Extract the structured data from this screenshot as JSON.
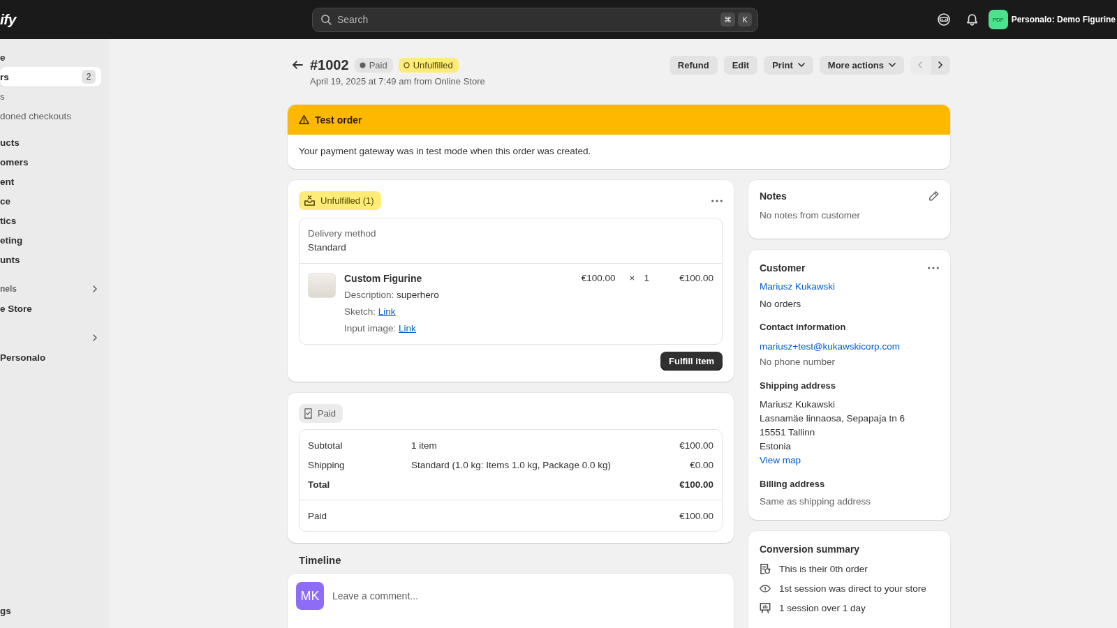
{
  "topbar": {
    "logo": "ify",
    "search": {
      "placeholder": "Search",
      "shortcut": [
        "⌘",
        "K"
      ]
    },
    "store": {
      "initials": "PDF",
      "name": "Personalo: Demo Figurine"
    }
  },
  "sidebar": {
    "groups": [
      {
        "items": [
          {
            "kind": "item",
            "label": "e",
            "selected": false
          },
          {
            "kind": "item",
            "label": "rs",
            "badge": "2",
            "selected": true
          },
          {
            "kind": "sub",
            "label": "s",
            "selected": false
          },
          {
            "kind": "sub",
            "label": "doned checkouts",
            "selected": false
          }
        ]
      },
      {
        "items": [
          {
            "kind": "item",
            "label": "ucts",
            "selected": false
          },
          {
            "kind": "item",
            "label": "omers",
            "selected": false
          },
          {
            "kind": "item",
            "label": "ent",
            "selected": false
          },
          {
            "kind": "item",
            "label": "ce",
            "selected": false
          },
          {
            "kind": "item",
            "label": "tics",
            "selected": false
          },
          {
            "kind": "item",
            "label": "eting",
            "selected": false
          },
          {
            "kind": "item",
            "label": "unts",
            "selected": false
          }
        ]
      },
      {
        "items": [
          {
            "kind": "section",
            "label": "nels"
          },
          {
            "kind": "item",
            "label": "e Store",
            "selected": false
          }
        ]
      },
      {
        "items": [
          {
            "kind": "section"
          },
          {
            "kind": "item",
            "label": "Personalo",
            "selected": false
          }
        ]
      }
    ],
    "footer": {
      "label": "gs",
      "selected": false
    }
  },
  "order": {
    "title": "#1002",
    "badges": [
      {
        "kind": "paid",
        "label": "Paid"
      },
      {
        "kind": "unfulfilled",
        "label": "Unfulfilled"
      }
    ],
    "subtitle": "April 19, 2025 at 7:49 am from Online Store",
    "actions": [
      {
        "label": "Refund",
        "dropdown": false
      },
      {
        "label": "Edit",
        "dropdown": false
      },
      {
        "label": "Print",
        "dropdown": true
      },
      {
        "label": "More actions",
        "dropdown": true
      }
    ],
    "pager": [
      {
        "kind": "previous",
        "disabled": true
      },
      {
        "kind": "next",
        "disabled": false
      }
    ]
  },
  "banner": {
    "title": "Test order",
    "message": "Your payment gateway was in test mode when this order was created."
  },
  "fulfillment": {
    "status": {
      "kind": "unfulfilled",
      "label": "Unfulfilled (1)"
    },
    "delivery": {
      "label": "Delivery method",
      "value": "Standard"
    },
    "line_items": [
      {
        "name": "Custom Figurine",
        "properties": [
          {
            "kind": "text",
            "label": "Description:",
            "value": "superhero"
          },
          {
            "kind": "link",
            "label": "Sketch:",
            "value": "Link"
          },
          {
            "kind": "link",
            "label": "Input image:",
            "value": "Link"
          }
        ],
        "price": "€100.00",
        "times": "×",
        "quantity": "1",
        "total": "€100.00"
      }
    ],
    "action": "Fulfill item"
  },
  "payment": {
    "status": {
      "kind": "paid",
      "label": "Paid"
    },
    "rows": [
      {
        "kind": "normal",
        "label": "Subtotal",
        "detail": "1 item",
        "amount": "€100.00"
      },
      {
        "kind": "normal",
        "label": "Shipping",
        "detail": "Standard (1.0 kg: Items 1.0 kg, Package 0.0 kg)",
        "amount": "€0.00"
      },
      {
        "kind": "total",
        "label": "Total",
        "amount": "€100.00"
      }
    ],
    "paid_rows": [
      {
        "label": "Paid",
        "amount": "€100.00"
      }
    ]
  },
  "timeline": {
    "title": "Timeline",
    "avatar": "MK",
    "placeholder": "Leave a comment..."
  },
  "notes": {
    "title": "Notes",
    "text": "No notes from customer"
  },
  "customer": {
    "title": "Customer",
    "name": "Mariusz Kukawski",
    "orders": "No orders",
    "contact": {
      "title": "Contact information",
      "email": "mariusz+test@kukawskicorp.com",
      "phone": "No phone number"
    },
    "shipping": {
      "title": "Shipping address",
      "lines": [
        "Mariusz Kukawski",
        "Lasnamäe linnaosa, Sepapaja tn 6",
        "15551 Tallinn",
        "Estonia"
      ],
      "link": "View map"
    },
    "billing": {
      "title": "Billing address",
      "text": "Same as shipping address"
    }
  },
  "conversion": {
    "title": "Conversion summary",
    "items": [
      {
        "kind": "orders",
        "text": "This is their 0th order"
      },
      {
        "kind": "session",
        "text": "1st session was direct to your store"
      },
      {
        "kind": "days",
        "text": "1 session over 1 day"
      }
    ]
  }
}
